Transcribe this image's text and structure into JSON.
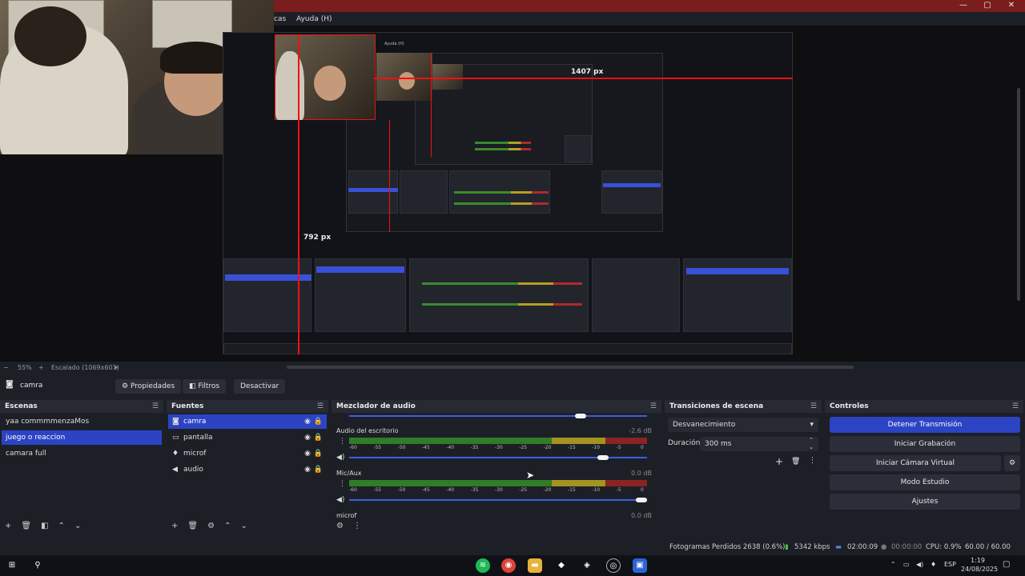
{
  "menu": {
    "partial_item": "cas",
    "help": "Ayuda (H)"
  },
  "preview": {
    "label_width": "1407 px",
    "label_height": "792 px",
    "nested_help": "Ayuda (H)",
    "zoom": "55%",
    "scale_label": "Escalado (1069x601)"
  },
  "context": {
    "source_name": "camra",
    "properties": "Propiedades",
    "filters": "Filtros",
    "deactivate": "Desactivar"
  },
  "scenes": {
    "title": "Escenas",
    "items": [
      {
        "label": "yaa commmmenzaMos"
      },
      {
        "label": "juego o reaccion"
      },
      {
        "label": "camara full"
      }
    ],
    "selected": 1
  },
  "sources": {
    "title": "Fuentes",
    "items": [
      {
        "label": "camra",
        "icon": "camera-icon"
      },
      {
        "label": "pantalla",
        "icon": "monitor-icon"
      },
      {
        "label": "microf",
        "icon": "microphone-icon"
      },
      {
        "label": "audio",
        "icon": "speaker-icon"
      }
    ],
    "selected": 0
  },
  "mixer": {
    "title": "Mezclador de audio",
    "channels": [
      {
        "name": "Audio del escritorio",
        "db": "-2.6 dB",
        "volume": 0.87
      },
      {
        "name": "Mic/Aux",
        "db": "0.0 dB",
        "volume": 1.0
      },
      {
        "name": "microf",
        "db": "0.0 dB"
      }
    ],
    "scale": [
      "-60",
      "-55",
      "-50",
      "-45",
      "-40",
      "-35",
      "-30",
      "-25",
      "-20",
      "-15",
      "-10",
      "-5",
      "0"
    ]
  },
  "transitions": {
    "title": "Transiciones de escena",
    "selected": "Desvanecimiento",
    "duration_label": "Duración",
    "duration_value": "300 ms"
  },
  "controls": {
    "title": "Controles",
    "stop_stream": "Detener Transmisión",
    "start_recording": "Iniciar Grabación",
    "start_virtual_cam": "Iniciar Cámara Virtual",
    "studio_mode": "Modo Estudio",
    "settings": "Ajustes"
  },
  "status": {
    "dropped_frames": "Fotogramas Perdidos 2638 (0.6%)",
    "bitrate": "5342 kbps",
    "stream_time": "02:00:09",
    "record_time": "00:00:00",
    "cpu": "CPU: 0.9%",
    "fps": "60.00 / 60.00 FPS"
  },
  "taskbar": {
    "lang": "ESP",
    "time": "1:19",
    "date": "24/08/2025"
  },
  "colors": {
    "accent": "#2c43c4",
    "titlebar": "#7a1d1d",
    "meter_green": "#2f7d26",
    "meter_yellow": "#a39320",
    "meter_red": "#8b2323"
  }
}
